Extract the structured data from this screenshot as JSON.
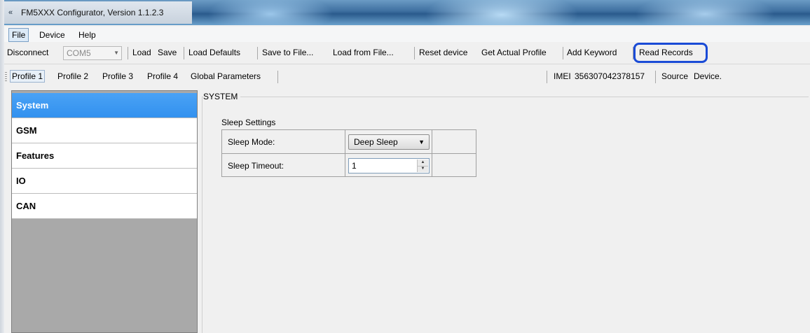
{
  "window": {
    "title": "FM5XXX Configurator, Version 1.1.2.3",
    "app_icon": "configurator-app-icon"
  },
  "menu": {
    "items": [
      {
        "label": "File"
      },
      {
        "label": "Device"
      },
      {
        "label": "Help"
      }
    ]
  },
  "toolbar": {
    "disconnect": "Disconnect",
    "port_value": "COM5",
    "load": "Load",
    "save": "Save",
    "load_defaults": "Load Defaults",
    "save_to_file": "Save to File...",
    "load_from_file": "Load from File...",
    "reset_device": "Reset device",
    "get_actual_profile": "Get Actual Profile",
    "add_keyword": "Add Keyword",
    "read_records": "Read Records",
    "highlight_color": "#1a4bd6"
  },
  "profiles": {
    "tabs": [
      {
        "label": "Profile 1",
        "active": true
      },
      {
        "label": "Profile 2"
      },
      {
        "label": "Profile 3"
      },
      {
        "label": "Profile 4"
      },
      {
        "label": "Global Parameters"
      }
    ],
    "imei_label": "IMEI",
    "imei_value": "356307042378157",
    "source_label": "Source",
    "source_value": "Device."
  },
  "sidebar": {
    "items": [
      {
        "label": "System",
        "selected": true
      },
      {
        "label": "GSM"
      },
      {
        "label": "Features"
      },
      {
        "label": "IO"
      },
      {
        "label": "CAN"
      }
    ],
    "selected_color": "#3b96f2"
  },
  "system": {
    "group_title": "SYSTEM",
    "sleep_settings_title": "Sleep Settings",
    "sleep_mode_label": "Sleep Mode:",
    "sleep_mode_value": "Deep Sleep",
    "sleep_timeout_label": "Sleep Timeout:",
    "sleep_timeout_value": "1"
  }
}
